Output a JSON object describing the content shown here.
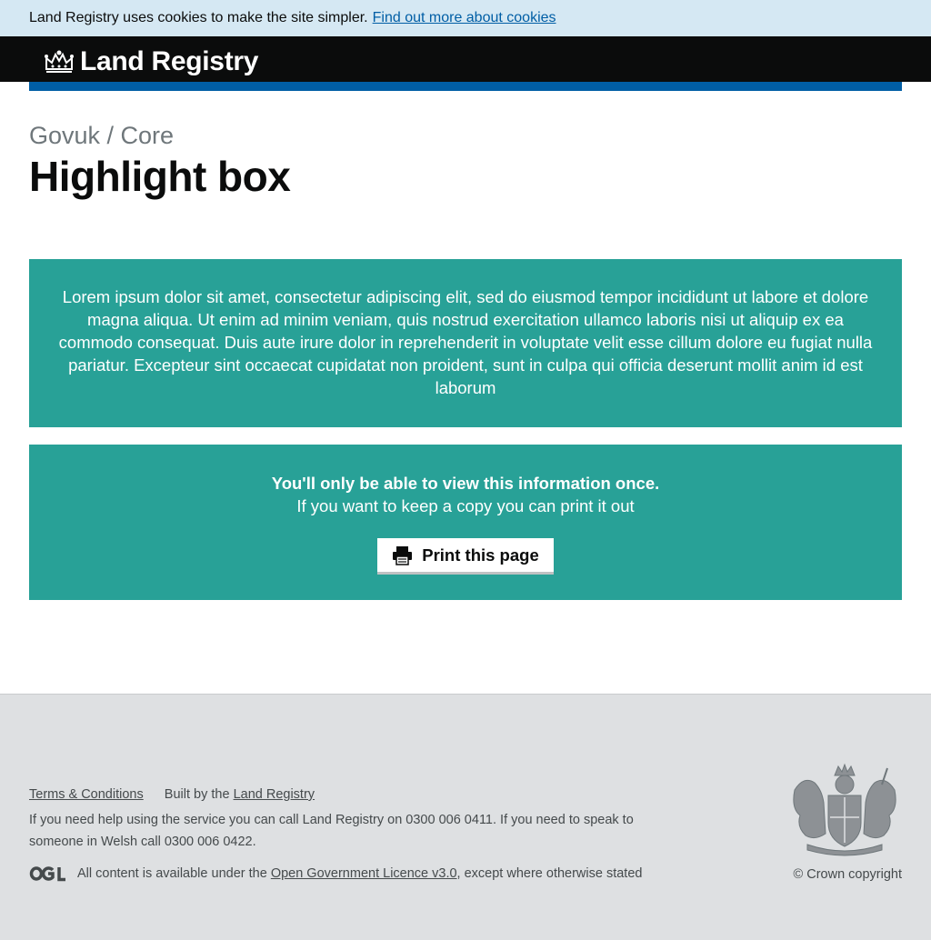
{
  "cookie_banner": {
    "text": "Land Registry uses cookies to make the site simpler.",
    "link": "Find out more about cookies"
  },
  "header": {
    "brand": "Land Registry",
    "icon": "crown-icon"
  },
  "page": {
    "caption": "Govuk / Core",
    "title": "Highlight box"
  },
  "highlight_1": {
    "text": "Lorem ipsum dolor sit amet, consectetur adipiscing elit, sed do eiusmod tempor incididunt ut labore et dolore magna aliqua. Ut enim ad minim veniam, quis nostrud exercitation ullamco laboris nisi ut aliquip ex ea commodo consequat. Duis aute irure dolor in reprehenderit in voluptate velit esse cillum dolore eu fugiat nulla pariatur. Excepteur sint occaecat cupidatat non proident, sunt in culpa qui officia deserunt mollit anim id est laborum"
  },
  "highlight_2": {
    "bold_text": "You'll only be able to view this information once.",
    "text": "If you want to keep a copy you can print it out",
    "print_button": "Print this page",
    "print_icon": "printer-icon"
  },
  "footer": {
    "terms_link": "Terms & Conditions",
    "built_by": "Built by the",
    "built_by_link": "Land Registry",
    "help_text": "If you need help using the service you can call Land Registry on 0300 006 0411. If you need to speak to someone in Welsh call 0300 006 0422.",
    "ogl_logo": "ogl-logo-icon",
    "licence_prefix": "All content is available under the",
    "licence_link": "Open Government Licence v3.0",
    "licence_suffix": ", except where otherwise stated",
    "crest": "royal-coat-of-arms-icon",
    "copyright": "© Crown copyright"
  },
  "colors": {
    "highlight": "#28a197",
    "header": "#0b0c0c",
    "header_bar": "#005ea5",
    "cookie_banner": "#d5e8f3",
    "footer": "#dee0e2"
  }
}
